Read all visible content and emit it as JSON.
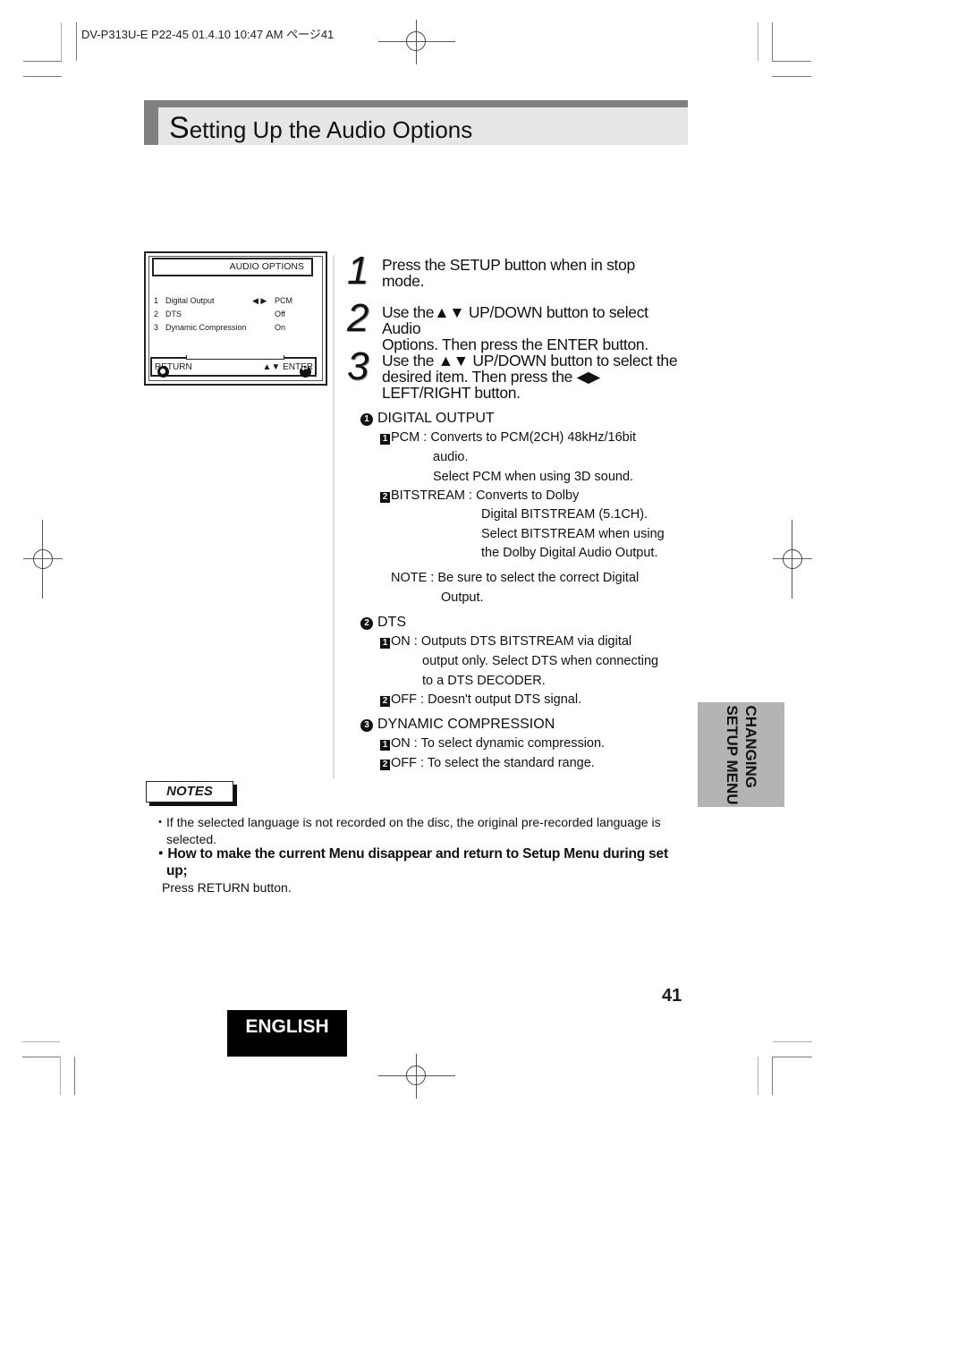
{
  "print_header": {
    "slug": "DV-P313U-E P22-45  01.4.10 10:47 AM  ページ41"
  },
  "title": {
    "first_letter": "S",
    "rest": "etting Up the Audio Options"
  },
  "osd_menu": {
    "header": "AUDIO OPTIONS",
    "rows": [
      {
        "num": "1",
        "label": "Digital Output",
        "arrows": "◀ ▶",
        "value": "PCM"
      },
      {
        "num": "2",
        "label": "DTS",
        "arrows": "",
        "value": "Off"
      },
      {
        "num": "3",
        "label": "Dynamic Compression",
        "arrows": "",
        "value": "On"
      }
    ],
    "footer": {
      "return_icon": "return-icon",
      "return_label": "RETURN",
      "updown_icon": "▲▼",
      "enter_icon": "enter-icon",
      "enter_label": "ENTER"
    }
  },
  "steps": [
    {
      "num": "1",
      "lines": [
        "Press the SETUP button when in stop",
        "mode."
      ]
    },
    {
      "num": "2",
      "lines": [
        "Use the▲▼ UP/DOWN button to select Audio",
        "Options. Then press the ENTER button."
      ]
    },
    {
      "num": "3",
      "lines": [
        "Use the ▲▼ UP/DOWN button to select the",
        "desired item. Then press the ◀▶",
        "LEFT/RIGHT button."
      ]
    }
  ],
  "sections": [
    {
      "badge": "1",
      "heading": "DIGITAL OUTPUT",
      "options": [
        {
          "badge": "1",
          "label": "PCM : ",
          "lines": [
            "Converts to PCM(2CH) 48kHz/16bit",
            "audio.",
            "Select PCM when using 3D sound."
          ]
        },
        {
          "badge": "2",
          "label": "BITSTREAM : ",
          "lines": [
            "Converts to Dolby",
            "Digital BITSTREAM (5.1CH).",
            "Select BITSTREAM when using",
            "the Dolby Digital Audio Output."
          ]
        }
      ],
      "note": {
        "label": "NOTE : ",
        "lines": [
          "Be sure to select the correct Digital",
          "Output."
        ]
      }
    },
    {
      "badge": "2",
      "heading": "DTS",
      "options": [
        {
          "badge": "1",
          "label": "ON : ",
          "lines": [
            "Outputs DTS BITSTREAM via digital",
            "output only. Select DTS when connecting",
            "to a DTS DECODER."
          ]
        },
        {
          "badge": "2",
          "label": "OFF : ",
          "lines": [
            "Doesn't output DTS signal."
          ]
        }
      ]
    },
    {
      "badge": "3",
      "heading": "DYNAMIC COMPRESSION",
      "options": [
        {
          "badge": "1",
          "label": "ON : ",
          "lines": [
            "To select dynamic compression."
          ]
        },
        {
          "badge": "2",
          "label": "OFF : ",
          "lines": [
            "To select the standard range."
          ]
        }
      ]
    }
  ],
  "side_tab": {
    "line1": "CHANGING",
    "line2": "SETUP MENU"
  },
  "notes": {
    "label": "NOTES",
    "items": [
      {
        "bullet": "・",
        "lines": [
          "If the selected language is not recorded on the disc, the original pre-recorded language is",
          "selected."
        ]
      },
      {
        "bullet": "・",
        "bold_lines": [
          "How to make the current Menu disappear and return to Setup Menu during set",
          "up;"
        ],
        "lines": [
          "Press RETURN button."
        ]
      }
    ]
  },
  "page_number": "41",
  "language_tab": "ENGLISH",
  "colors": {
    "title_band": "#e6e6e6",
    "title_accent": "#808080",
    "side_tab": "#b4b4b4",
    "language_tab": "#000000"
  }
}
